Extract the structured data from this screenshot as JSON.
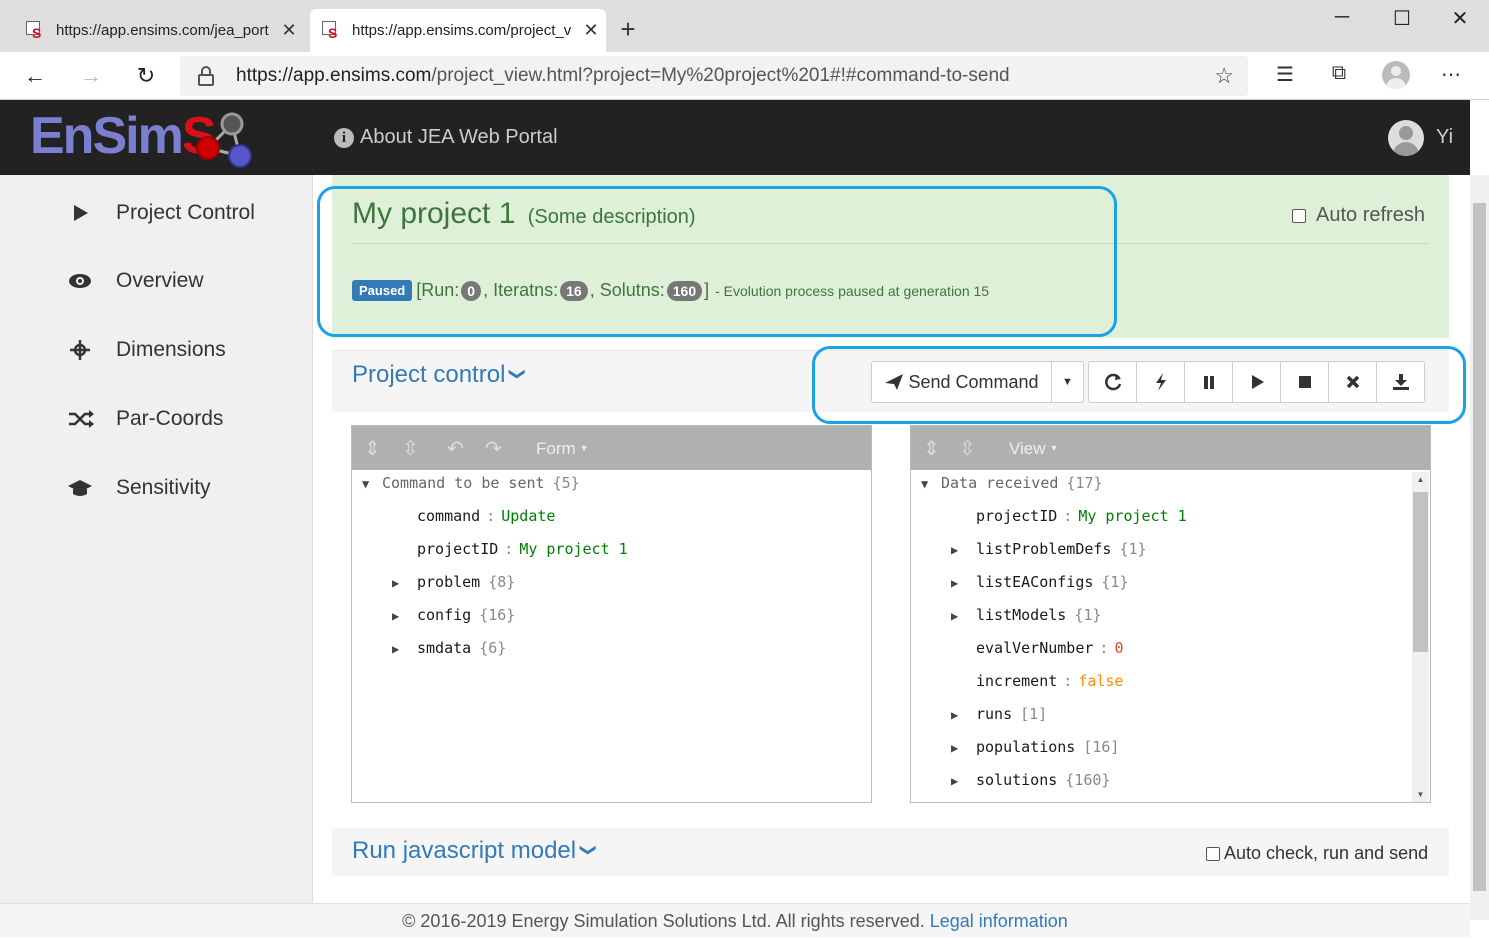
{
  "browser": {
    "tabs": [
      {
        "title": "https://app.ensims.com/jea_port",
        "active": false
      },
      {
        "title": "https://app.ensims.com/project_v",
        "active": true
      }
    ],
    "url": {
      "host": "https://app.ensims.com",
      "path": "/project_view.html?project=My%20project%201#!#command-to-send"
    },
    "window_controls": {
      "minimize": "─",
      "maximize": "☐",
      "close": "✕"
    }
  },
  "header": {
    "logo": {
      "part1": "EnSim",
      "part2": "S"
    },
    "about_label": "About JEA Web Portal",
    "user_name": "Yi"
  },
  "sidebar": {
    "items": [
      {
        "label": "Project Control",
        "icon": "play-icon"
      },
      {
        "label": "Overview",
        "icon": "eye-icon"
      },
      {
        "label": "Dimensions",
        "icon": "crosshair-icon"
      },
      {
        "label": "Par-Coords",
        "icon": "shuffle-icon"
      },
      {
        "label": "Sensitivity",
        "icon": "graduation-cap-icon"
      }
    ]
  },
  "project": {
    "name": "My project 1",
    "description": "(Some description)",
    "auto_refresh_label": "Auto refresh",
    "auto_refresh_checked": false,
    "status_label": "Paused",
    "run_label": "[Run:",
    "run": "0",
    "iter_label": ", Iteratns:",
    "iterations": "16",
    "sol_label": ", Solutns:",
    "solutions": "160",
    "close_bracket": "]",
    "status_message": "- Evolution process paused at generation 15"
  },
  "control": {
    "title": "Project control",
    "send_label": "Send Command",
    "buttons": [
      "refresh-icon",
      "bolt-icon",
      "pause-icon",
      "play-icon",
      "stop-icon",
      "remove-icon",
      "download-icon"
    ]
  },
  "editor_left": {
    "mode_label": "Form",
    "root": {
      "key": "Command to be sent",
      "count": "{5}"
    },
    "fields": [
      {
        "key": "command",
        "value": "Update",
        "type": "string"
      },
      {
        "key": "projectID",
        "value": "My project 1",
        "type": "string"
      },
      {
        "key": "problem",
        "count": "{8}"
      },
      {
        "key": "config",
        "count": "{16}"
      },
      {
        "key": "smdata",
        "count": "{6}"
      }
    ]
  },
  "editor_right": {
    "mode_label": "View",
    "root": {
      "key": "Data received",
      "count": "{17}"
    },
    "fields": [
      {
        "key": "projectID",
        "value": "My project 1",
        "type": "string"
      },
      {
        "key": "listProblemDefs",
        "count": "{1}"
      },
      {
        "key": "listEAConfigs",
        "count": "{1}"
      },
      {
        "key": "listModels",
        "count": "{1}"
      },
      {
        "key": "evalVerNumber",
        "value": "0",
        "type": "number"
      },
      {
        "key": "increment",
        "value": "false",
        "type": "boolean"
      },
      {
        "key": "runs",
        "count": "[1]"
      },
      {
        "key": "populations",
        "count": "[16]"
      },
      {
        "key": "solutions",
        "count": "{160}"
      }
    ]
  },
  "run_model": {
    "title": "Run javascript model",
    "auto_check_label": "Auto check, run and send",
    "auto_check_checked": false
  },
  "footer": {
    "copyright": "© 2016-2019 Energy Simulation Solutions Ltd. All rights reserved.",
    "legal_link": "Legal information"
  },
  "colors": {
    "accent": "#337ab7",
    "success_bg": "#dff0d8",
    "success_text": "#3c763d",
    "highlight": "#1aa1e6"
  }
}
